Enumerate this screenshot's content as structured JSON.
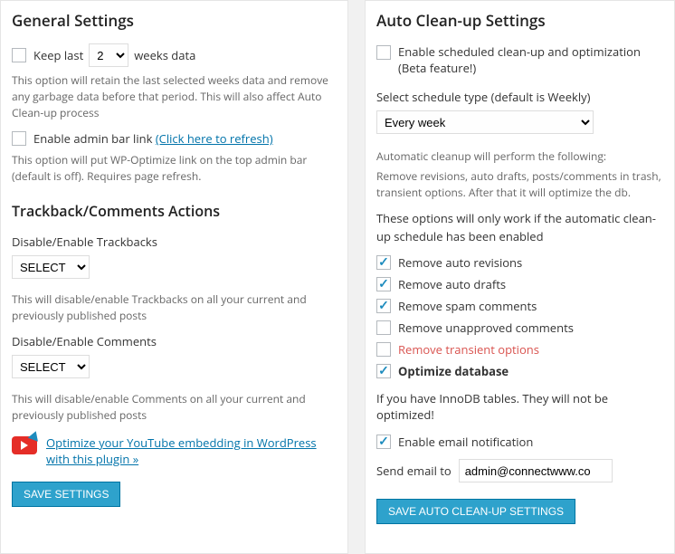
{
  "left": {
    "title": "General Settings",
    "keepLast": {
      "label_pre": "Keep last",
      "label_post": "weeks data",
      "value": "2",
      "desc": "This option will retain the last selected weeks data and remove any garbage data before that period. This will also affect Auto Clean-up process"
    },
    "adminBar": {
      "label": "Enable admin bar link",
      "refresh": "(Click here to refresh)",
      "desc": "This option will put WP-Optimize link on the top admin bar (default is off). Requires page refresh."
    },
    "trackbackTitle": "Trackback/Comments Actions",
    "tb": {
      "label": "Disable/Enable Trackbacks",
      "value": "SELECT",
      "desc": "This will disable/enable Trackbacks on all your current and previously published posts"
    },
    "cm": {
      "label": "Disable/Enable Comments",
      "value": "SELECT",
      "desc": "This will disable/enable Comments on all your current and previously published posts"
    },
    "ytLink": "Optimize your YouTube embedding in WordPress with this plugin »",
    "saveBtn": "SAVE SETTINGS"
  },
  "right": {
    "title": "Auto Clean-up Settings",
    "enable": "Enable scheduled clean-up and optimization (Beta feature!)",
    "scheduleLabel": "Select schedule type (default is Weekly)",
    "scheduleValue": "Every week",
    "autoDesc1": "Automatic cleanup will perform the following:",
    "autoDesc2": "Remove revisions, auto drafts, posts/comments in trash, transient options. After that it will optimize the db.",
    "workNote": "These options will only work if the automatic clean-up schedule has been enabled",
    "opts": {
      "revisions": "Remove auto revisions",
      "drafts": "Remove auto drafts",
      "spam": "Remove spam comments",
      "unapproved": "Remove unapproved comments",
      "transient": "Remove transient options",
      "optimize": "Optimize database"
    },
    "innodb": "If you have InnoDB tables. They will not be optimized!",
    "email": "Enable email notification",
    "sendLabel": "Send email to",
    "sendValue": "admin@connectwww.co",
    "saveBtn": "SAVE AUTO CLEAN-UP SETTINGS"
  }
}
